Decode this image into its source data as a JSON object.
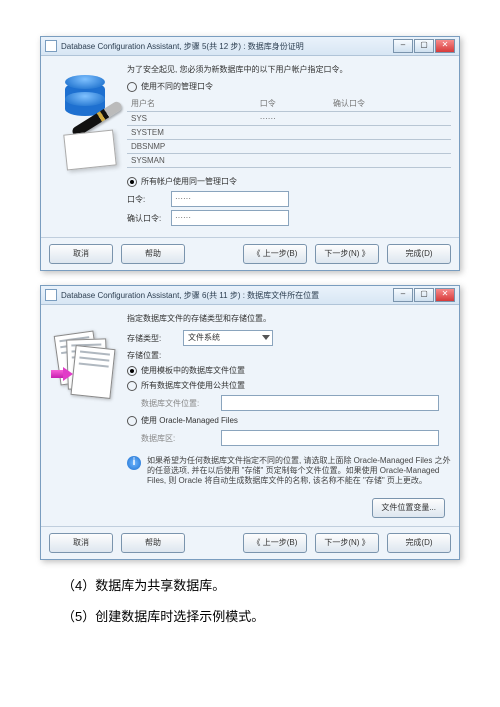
{
  "dlg1": {
    "title": "Database Configuration Assistant, 步骤 5(共 12 步) : 数据库身份证明",
    "hint": "为了安全起见, 您必须为新数据库中的以下用户帐户指定口令。",
    "optDiff": "使用不同的管理口令",
    "cols": {
      "user": "用户名",
      "pw": "口令",
      "pw2": "确认口令"
    },
    "rows": [
      {
        "user": "SYS",
        "pw": "······"
      },
      {
        "user": "SYSTEM",
        "pw": ""
      },
      {
        "user": "DBSNMP",
        "pw": ""
      },
      {
        "user": "SYSMAN",
        "pw": ""
      }
    ],
    "optSame": "所有帐户使用同一管理口令",
    "pwLabel": "口令:",
    "pw2Label": "确认口令:",
    "pwMask": "······"
  },
  "dlg2": {
    "title": "Database Configuration Assistant, 步骤 6(共 11 步) : 数据库文件所在位置",
    "hint": "指定数据库文件的存储类型和存储位置。",
    "storageTypeLabel": "存储类型:",
    "storageTypeValue": "文件系统",
    "storageLocLabel": "存储位置:",
    "optTemplate": "使用模板中的数据库文件位置",
    "optCommon": "所有数据库文件使用公共位置",
    "dbFileLocLabel": "数据库文件位置:",
    "optOMF": "使用 Oracle-Managed Files",
    "dbAreaLabel": "数据库区:",
    "info": "如果希望为任何数据库文件指定不同的位置, 请选取上面除 Oracle-Managed Files 之外的任意选项, 并在以后使用 \"存储\" 页定制每个文件位置。如果使用 Oracle-Managed Files, 则 Oracle 将自动生成数据库文件的名称, 该名称不能在 \"存储\" 页上更改。",
    "fileLocBtn": "文件位置变量..."
  },
  "nav": {
    "cancel": "取消",
    "help": "帮助",
    "back": "《 上一步(B)",
    "next": "下一步(N) 》",
    "finish": "完成(D)"
  },
  "body": {
    "line4": "（4）数据库为共享数据库。",
    "line5": "（5）创建数据库时选择示例模式。"
  }
}
